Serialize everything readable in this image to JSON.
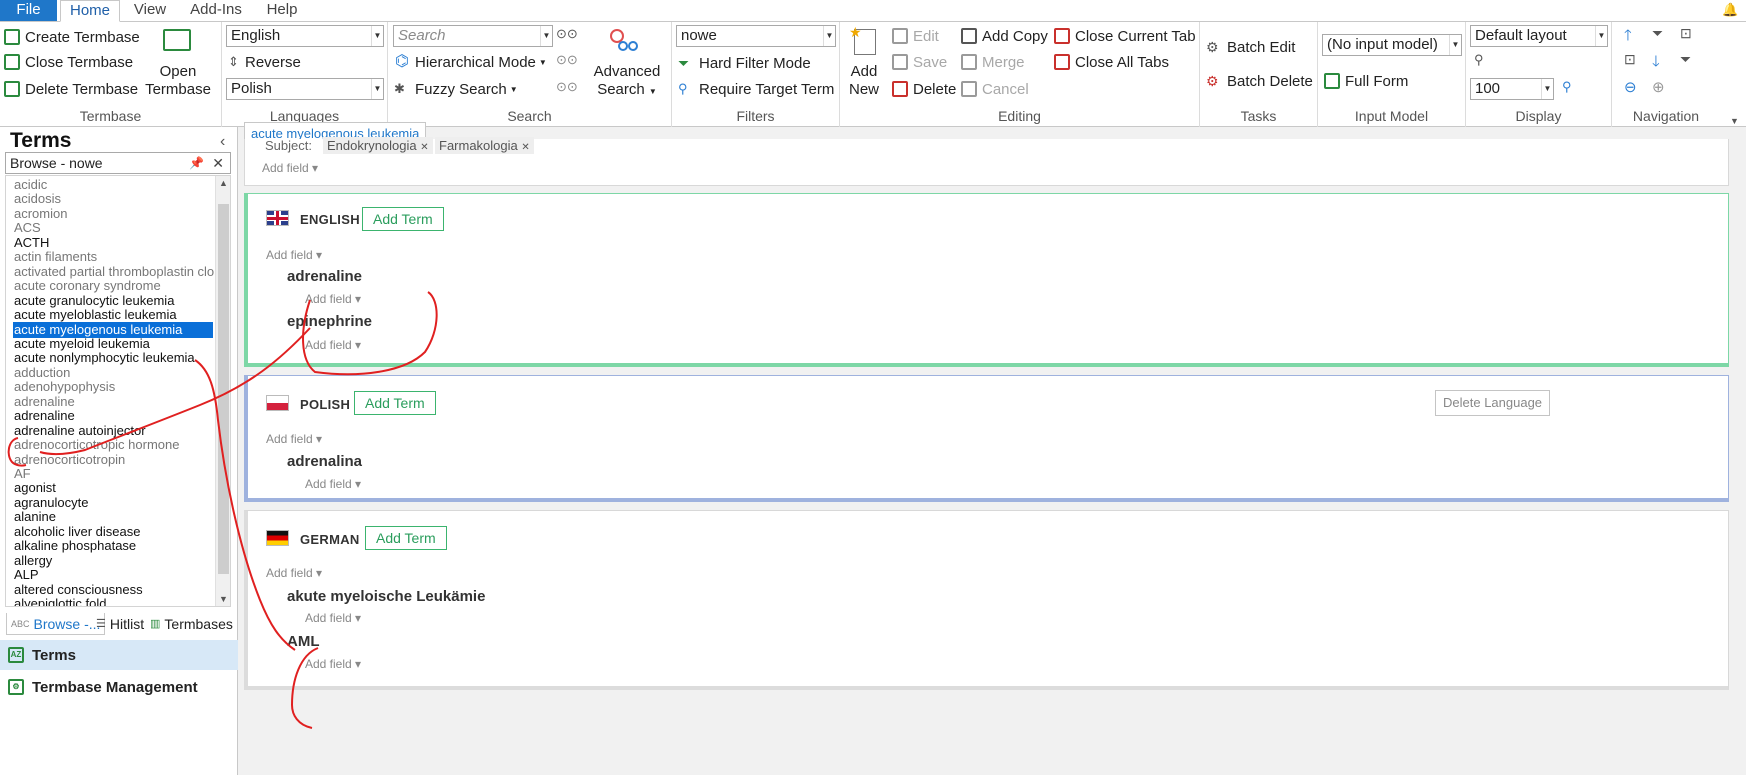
{
  "menu": {
    "file": "File",
    "tabs": [
      "Home",
      "View",
      "Add-Ins",
      "Help"
    ]
  },
  "ribbon": {
    "termbase": {
      "title": "Termbase",
      "create": "Create Termbase",
      "close": "Close Termbase",
      "delete": "Delete Termbase",
      "open_line1": "Open",
      "open_line2": "Termbase"
    },
    "languages": {
      "title": "Languages",
      "source": "English",
      "reverse": "Reverse",
      "target": "Polish"
    },
    "search": {
      "title": "Search",
      "placeholder": "Search",
      "hierarchical": "Hierarchical Mode",
      "fuzzy": "Fuzzy Search",
      "advanced_line1": "Advanced",
      "advanced_line2": "Search"
    },
    "filters": {
      "title": "Filters",
      "value": "nowe",
      "hard": "Hard Filter Mode",
      "require": "Require Target Term"
    },
    "editing": {
      "title": "Editing",
      "add_new_line1": "Add",
      "add_new_line2": "New",
      "edit": "Edit",
      "save": "Save",
      "delete": "Delete",
      "add_copy": "Add Copy",
      "merge": "Merge",
      "cancel": "Cancel",
      "close_current": "Close Current Tab",
      "close_all": "Close All Tabs"
    },
    "tasks": {
      "title": "Tasks",
      "batch_edit": "Batch Edit",
      "batch_delete": "Batch Delete"
    },
    "input_model": {
      "title": "Input Model",
      "value": "(No input model)",
      "full_form": "Full Form"
    },
    "display": {
      "title": "Display",
      "layout": "Default layout",
      "zoom": "100"
    },
    "navigation": {
      "title": "Navigation"
    }
  },
  "left_panel": {
    "title": "Terms",
    "browse": "Browse - nowe",
    "terms": [
      {
        "text": "acidic",
        "style": "gray"
      },
      {
        "text": "acidosis",
        "style": "gray"
      },
      {
        "text": "acromion",
        "style": "gray"
      },
      {
        "text": "ACS",
        "style": "gray"
      },
      {
        "text": "ACTH",
        "style": "dark"
      },
      {
        "text": "actin filaments",
        "style": "gray"
      },
      {
        "text": "activated partial thromboplastin clotting",
        "style": "gray"
      },
      {
        "text": "acute coronary syndrome",
        "style": "gray"
      },
      {
        "text": "acute granulocytic leukemia",
        "style": "dark"
      },
      {
        "text": "acute myeloblastic leukemia",
        "style": "dark"
      },
      {
        "text": "acute myelogenous leukemia",
        "style": "sel"
      },
      {
        "text": "acute myeloid leukemia",
        "style": "dark"
      },
      {
        "text": "acute nonlymphocytic leukemia",
        "style": "dark"
      },
      {
        "text": "adduction",
        "style": "gray"
      },
      {
        "text": "adenohypophysis",
        "style": "gray"
      },
      {
        "text": "adrenaline",
        "style": "gray"
      },
      {
        "text": "adrenaline",
        "style": "dark"
      },
      {
        "text": "adrenaline autoinjector",
        "style": "dark"
      },
      {
        "text": "adrenocorticotropic hormone",
        "style": "gray"
      },
      {
        "text": "adrenocorticotropin",
        "style": "gray"
      },
      {
        "text": "AF",
        "style": "gray"
      },
      {
        "text": "agonist",
        "style": "dark"
      },
      {
        "text": "agranulocyte",
        "style": "dark"
      },
      {
        "text": "alanine",
        "style": "dark"
      },
      {
        "text": "alcoholic liver disease",
        "style": "dark"
      },
      {
        "text": "alkaline phosphatase",
        "style": "dark"
      },
      {
        "text": "allergy",
        "style": "dark"
      },
      {
        "text": "ALP",
        "style": "dark"
      },
      {
        "text": "altered consciousness",
        "style": "dark"
      },
      {
        "text": "alyepiglottic fold",
        "style": "dark"
      }
    ],
    "tabs": {
      "browse": "Browse -...",
      "hitlist": "Hitlist",
      "termbases": "Termbases"
    },
    "nav": {
      "terms": "Terms",
      "management": "Termbase Management"
    }
  },
  "entry": {
    "tab_title": "acute myelogenous leukemia",
    "subject_label": "Subject:",
    "subjects": [
      "Endokrynologia",
      "Farmakologia"
    ],
    "add_field": "Add field",
    "add_term": "Add Term",
    "delete_language": "Delete Language",
    "languages": [
      {
        "name": "ENGLISH",
        "terms": [
          "adrenaline",
          "epinephrine"
        ]
      },
      {
        "name": "POLISH",
        "terms": [
          "adrenalina"
        ]
      },
      {
        "name": "GERMAN",
        "terms": [
          "akute myeloische Leukämie",
          "AML"
        ]
      }
    ]
  },
  "colors": {
    "accent": "#1f77c9",
    "selection": "#0a6fd8",
    "english_border": "#7dd7a6",
    "polish_border": "#9fb2de",
    "annotation": "#e02020"
  }
}
